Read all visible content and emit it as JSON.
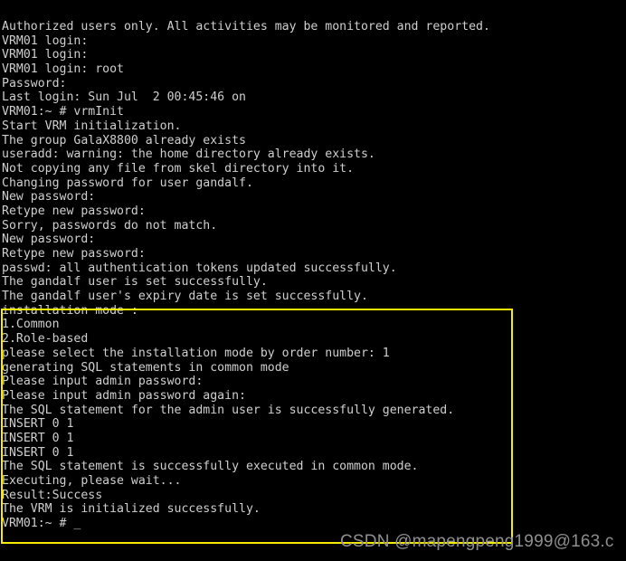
{
  "terminal": {
    "background_color": "#000000",
    "text_color": "#cfcfcf",
    "lines": [
      "Authorized users only. All activities may be monitored and reported.",
      "VRM01 login:",
      "VRM01 login:",
      "VRM01 login: root",
      "Password:",
      "Last login: Sun Jul  2 00:45:46 on",
      "VRM01:~ # vrmInit",
      "Start VRM initialization.",
      "The group GalaX8800 already exists",
      "useradd: warning: the home directory already exists.",
      "Not copying any file from skel directory into it.",
      "Changing password for user gandalf.",
      "New password:",
      "Retype new password:",
      "Sorry, passwords do not match.",
      "New password:",
      "Retype new password:",
      "passwd: all authentication tokens updated successfully.",
      "The gandalf user is set successfully.",
      "The gandalf user's expiry date is set successfully.",
      "installation mode :",
      "1.Common",
      "2.Role-based",
      "please select the installation mode by order number: 1",
      "generating SQL statements in common mode",
      "Please input admin password:",
      "Please input admin password again:",
      "The SQL statement for the admin user is successfully generated.",
      "INSERT 0 1",
      "INSERT 0 1",
      "INSERT 0 1",
      "The SQL statement is successfully executed in common mode.",
      "Executing, please wait...",
      "Result:Success",
      "The VRM is initialized successfully.",
      "VRM01:~ # _"
    ]
  },
  "highlight_box": {
    "color": "#f5ec00",
    "label": "installation-mode-highlight"
  },
  "watermark": {
    "text": "CSDN @mapengpeng1999@163.c",
    "color": "#8f8f8f"
  }
}
